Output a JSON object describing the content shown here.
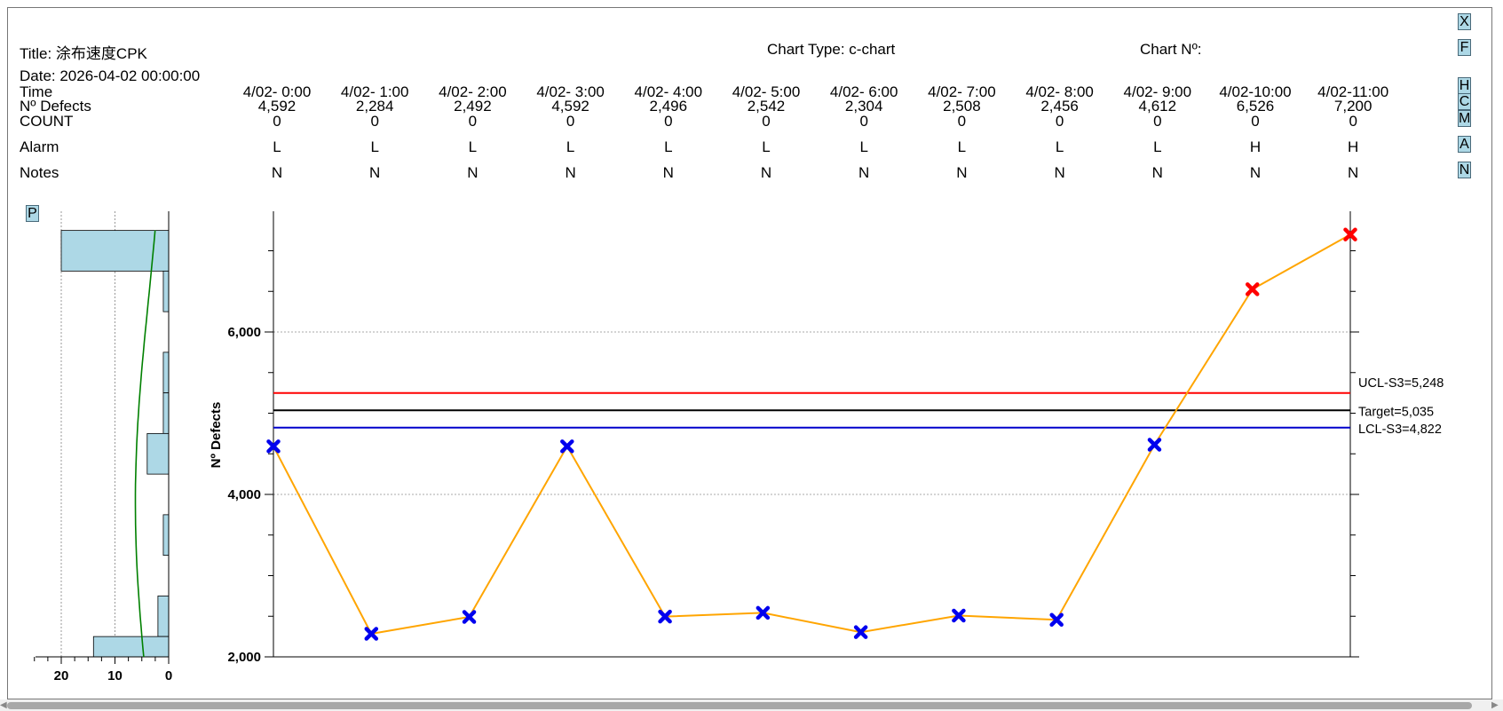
{
  "header": {
    "title": "Title: 涂布速度CPK",
    "chart_type": "Chart Type: c-chart",
    "chart_no": "Chart Nº:",
    "date": "Date: 2026-04-02 00:00:00"
  },
  "rows": {
    "time_label": "Time",
    "defects_label": "Nº Defects",
    "count_label": "COUNT",
    "alarm_label": "Alarm",
    "notes_label": "Notes"
  },
  "columns": [
    {
      "time": "4/02- 0:00",
      "defects": "4,592",
      "count": "0",
      "alarm": "L",
      "notes": "N"
    },
    {
      "time": "4/02- 1:00",
      "defects": "2,284",
      "count": "0",
      "alarm": "L",
      "notes": "N"
    },
    {
      "time": "4/02- 2:00",
      "defects": "2,492",
      "count": "0",
      "alarm": "L",
      "notes": "N"
    },
    {
      "time": "4/02- 3:00",
      "defects": "4,592",
      "count": "0",
      "alarm": "L",
      "notes": "N"
    },
    {
      "time": "4/02- 4:00",
      "defects": "2,496",
      "count": "0",
      "alarm": "L",
      "notes": "N"
    },
    {
      "time": "4/02- 5:00",
      "defects": "2,542",
      "count": "0",
      "alarm": "L",
      "notes": "N"
    },
    {
      "time": "4/02- 6:00",
      "defects": "2,304",
      "count": "0",
      "alarm": "L",
      "notes": "N"
    },
    {
      "time": "4/02- 7:00",
      "defects": "2,508",
      "count": "0",
      "alarm": "L",
      "notes": "N"
    },
    {
      "time": "4/02- 8:00",
      "defects": "2,456",
      "count": "0",
      "alarm": "L",
      "notes": "N"
    },
    {
      "time": "4/02- 9:00",
      "defects": "4,612",
      "count": "0",
      "alarm": "L",
      "notes": "N"
    },
    {
      "time": "4/02-10:00",
      "defects": "6,526",
      "count": "0",
      "alarm": "H",
      "notes": "N"
    },
    {
      "time": "4/02-11:00",
      "defects": "7,200",
      "count": "0",
      "alarm": "H",
      "notes": "N"
    }
  ],
  "side_buttons": [
    {
      "key": "x",
      "label": "X"
    },
    {
      "key": "f",
      "label": "F"
    },
    {
      "key": "h",
      "label": "H"
    },
    {
      "key": "c",
      "label": "C"
    },
    {
      "key": "m",
      "label": "M"
    },
    {
      "key": "a",
      "label": "A"
    },
    {
      "key": "n",
      "label": "N"
    }
  ],
  "p_button": "P",
  "colors": {
    "line": "#ffa500",
    "point_in": "#0000ee",
    "point_out": "#ff0000",
    "ucl": "#ff0000",
    "lcl": "#0000cc",
    "target": "#000000",
    "hist_fill": "#add8e6",
    "normal_curve": "#008000"
  },
  "chart_data": {
    "type": "line",
    "ylabel": "Nº Defects",
    "ylim": [
      2000,
      7250
    ],
    "yticks": [
      2000,
      4000,
      6000
    ],
    "ytick_labels": [
      "2,000",
      "4,000",
      "6,000"
    ],
    "x": [
      "4/02- 0:00",
      "4/02- 1:00",
      "4/02- 2:00",
      "4/02- 3:00",
      "4/02- 4:00",
      "4/02- 5:00",
      "4/02- 6:00",
      "4/02- 7:00",
      "4/02- 8:00",
      "4/02- 9:00",
      "4/02-10:00",
      "4/02-11:00"
    ],
    "values": [
      4592,
      2284,
      2492,
      4592,
      2496,
      2542,
      2304,
      2508,
      2456,
      4612,
      6526,
      7200
    ],
    "ucl": 5248,
    "target": 5035,
    "lcl": 4822,
    "ucl_label": "UCL-S3=5,248",
    "target_label": "Target=5,035",
    "lcl_label": "LCL-S3=4,822",
    "grid": true,
    "histogram": {
      "xlabels": [
        "20",
        "10",
        "0"
      ],
      "xlim": [
        25,
        0
      ],
      "bins": [
        {
          "lo": 6750,
          "hi": 7250,
          "count": 20
        },
        {
          "lo": 6250,
          "hi": 6750,
          "count": 1
        },
        {
          "lo": 5750,
          "hi": 6250,
          "count": 0
        },
        {
          "lo": 5250,
          "hi": 5750,
          "count": 1
        },
        {
          "lo": 4750,
          "hi": 5250,
          "count": 1
        },
        {
          "lo": 4250,
          "hi": 4750,
          "count": 4
        },
        {
          "lo": 3750,
          "hi": 4250,
          "count": 0
        },
        {
          "lo": 3250,
          "hi": 3750,
          "count": 1
        },
        {
          "lo": 2750,
          "hi": 3250,
          "count": 0
        },
        {
          "lo": 2250,
          "hi": 2750,
          "count": 2
        },
        {
          "lo": 1750,
          "hi": 2250,
          "count": 14
        }
      ]
    }
  }
}
